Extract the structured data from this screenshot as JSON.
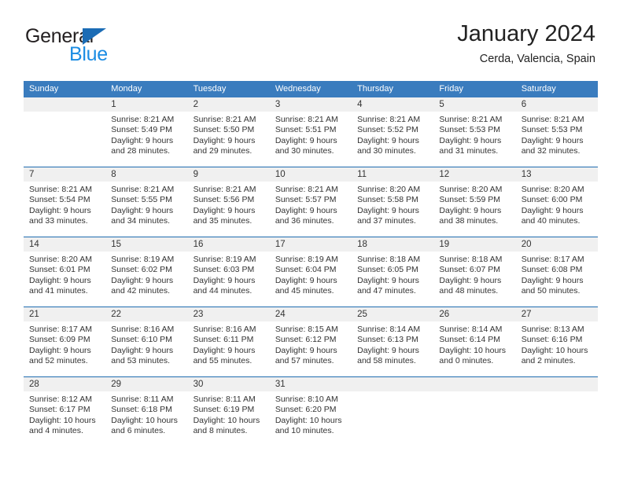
{
  "brand": {
    "name_part1": "General",
    "name_part2": "Blue",
    "logo_icon": "blue-triangle-logo"
  },
  "header": {
    "title": "January 2024",
    "location": "Cerda, Valencia, Spain"
  },
  "theme": {
    "header_blue": "#3a7cbe",
    "week_divider_blue": "#1f6cb0",
    "date_band_gray": "#f0f0f0",
    "brand_blue": "#1b8ce3",
    "logo_blue": "#1b6cb5",
    "text": "#333333"
  },
  "calendar": {
    "day_headers": [
      "Sunday",
      "Monday",
      "Tuesday",
      "Wednesday",
      "Thursday",
      "Friday",
      "Saturday"
    ],
    "weeks": [
      {
        "days": [
          {
            "num": "",
            "lines": []
          },
          {
            "num": "1",
            "lines": [
              "Sunrise: 8:21 AM",
              "Sunset: 5:49 PM",
              "Daylight: 9 hours",
              "and 28 minutes."
            ]
          },
          {
            "num": "2",
            "lines": [
              "Sunrise: 8:21 AM",
              "Sunset: 5:50 PM",
              "Daylight: 9 hours",
              "and 29 minutes."
            ]
          },
          {
            "num": "3",
            "lines": [
              "Sunrise: 8:21 AM",
              "Sunset: 5:51 PM",
              "Daylight: 9 hours",
              "and 30 minutes."
            ]
          },
          {
            "num": "4",
            "lines": [
              "Sunrise: 8:21 AM",
              "Sunset: 5:52 PM",
              "Daylight: 9 hours",
              "and 30 minutes."
            ]
          },
          {
            "num": "5",
            "lines": [
              "Sunrise: 8:21 AM",
              "Sunset: 5:53 PM",
              "Daylight: 9 hours",
              "and 31 minutes."
            ]
          },
          {
            "num": "6",
            "lines": [
              "Sunrise: 8:21 AM",
              "Sunset: 5:53 PM",
              "Daylight: 9 hours",
              "and 32 minutes."
            ]
          }
        ]
      },
      {
        "days": [
          {
            "num": "7",
            "lines": [
              "Sunrise: 8:21 AM",
              "Sunset: 5:54 PM",
              "Daylight: 9 hours",
              "and 33 minutes."
            ]
          },
          {
            "num": "8",
            "lines": [
              "Sunrise: 8:21 AM",
              "Sunset: 5:55 PM",
              "Daylight: 9 hours",
              "and 34 minutes."
            ]
          },
          {
            "num": "9",
            "lines": [
              "Sunrise: 8:21 AM",
              "Sunset: 5:56 PM",
              "Daylight: 9 hours",
              "and 35 minutes."
            ]
          },
          {
            "num": "10",
            "lines": [
              "Sunrise: 8:21 AM",
              "Sunset: 5:57 PM",
              "Daylight: 9 hours",
              "and 36 minutes."
            ]
          },
          {
            "num": "11",
            "lines": [
              "Sunrise: 8:20 AM",
              "Sunset: 5:58 PM",
              "Daylight: 9 hours",
              "and 37 minutes."
            ]
          },
          {
            "num": "12",
            "lines": [
              "Sunrise: 8:20 AM",
              "Sunset: 5:59 PM",
              "Daylight: 9 hours",
              "and 38 minutes."
            ]
          },
          {
            "num": "13",
            "lines": [
              "Sunrise: 8:20 AM",
              "Sunset: 6:00 PM",
              "Daylight: 9 hours",
              "and 40 minutes."
            ]
          }
        ]
      },
      {
        "days": [
          {
            "num": "14",
            "lines": [
              "Sunrise: 8:20 AM",
              "Sunset: 6:01 PM",
              "Daylight: 9 hours",
              "and 41 minutes."
            ]
          },
          {
            "num": "15",
            "lines": [
              "Sunrise: 8:19 AM",
              "Sunset: 6:02 PM",
              "Daylight: 9 hours",
              "and 42 minutes."
            ]
          },
          {
            "num": "16",
            "lines": [
              "Sunrise: 8:19 AM",
              "Sunset: 6:03 PM",
              "Daylight: 9 hours",
              "and 44 minutes."
            ]
          },
          {
            "num": "17",
            "lines": [
              "Sunrise: 8:19 AM",
              "Sunset: 6:04 PM",
              "Daylight: 9 hours",
              "and 45 minutes."
            ]
          },
          {
            "num": "18",
            "lines": [
              "Sunrise: 8:18 AM",
              "Sunset: 6:05 PM",
              "Daylight: 9 hours",
              "and 47 minutes."
            ]
          },
          {
            "num": "19",
            "lines": [
              "Sunrise: 8:18 AM",
              "Sunset: 6:07 PM",
              "Daylight: 9 hours",
              "and 48 minutes."
            ]
          },
          {
            "num": "20",
            "lines": [
              "Sunrise: 8:17 AM",
              "Sunset: 6:08 PM",
              "Daylight: 9 hours",
              "and 50 minutes."
            ]
          }
        ]
      },
      {
        "days": [
          {
            "num": "21",
            "lines": [
              "Sunrise: 8:17 AM",
              "Sunset: 6:09 PM",
              "Daylight: 9 hours",
              "and 52 minutes."
            ]
          },
          {
            "num": "22",
            "lines": [
              "Sunrise: 8:16 AM",
              "Sunset: 6:10 PM",
              "Daylight: 9 hours",
              "and 53 minutes."
            ]
          },
          {
            "num": "23",
            "lines": [
              "Sunrise: 8:16 AM",
              "Sunset: 6:11 PM",
              "Daylight: 9 hours",
              "and 55 minutes."
            ]
          },
          {
            "num": "24",
            "lines": [
              "Sunrise: 8:15 AM",
              "Sunset: 6:12 PM",
              "Daylight: 9 hours",
              "and 57 minutes."
            ]
          },
          {
            "num": "25",
            "lines": [
              "Sunrise: 8:14 AM",
              "Sunset: 6:13 PM",
              "Daylight: 9 hours",
              "and 58 minutes."
            ]
          },
          {
            "num": "26",
            "lines": [
              "Sunrise: 8:14 AM",
              "Sunset: 6:14 PM",
              "Daylight: 10 hours",
              "and 0 minutes."
            ]
          },
          {
            "num": "27",
            "lines": [
              "Sunrise: 8:13 AM",
              "Sunset: 6:16 PM",
              "Daylight: 10 hours",
              "and 2 minutes."
            ]
          }
        ]
      },
      {
        "days": [
          {
            "num": "28",
            "lines": [
              "Sunrise: 8:12 AM",
              "Sunset: 6:17 PM",
              "Daylight: 10 hours",
              "and 4 minutes."
            ]
          },
          {
            "num": "29",
            "lines": [
              "Sunrise: 8:11 AM",
              "Sunset: 6:18 PM",
              "Daylight: 10 hours",
              "and 6 minutes."
            ]
          },
          {
            "num": "30",
            "lines": [
              "Sunrise: 8:11 AM",
              "Sunset: 6:19 PM",
              "Daylight: 10 hours",
              "and 8 minutes."
            ]
          },
          {
            "num": "31",
            "lines": [
              "Sunrise: 8:10 AM",
              "Sunset: 6:20 PM",
              "Daylight: 10 hours",
              "and 10 minutes."
            ]
          },
          {
            "num": "",
            "lines": []
          },
          {
            "num": "",
            "lines": []
          },
          {
            "num": "",
            "lines": []
          }
        ]
      }
    ]
  }
}
